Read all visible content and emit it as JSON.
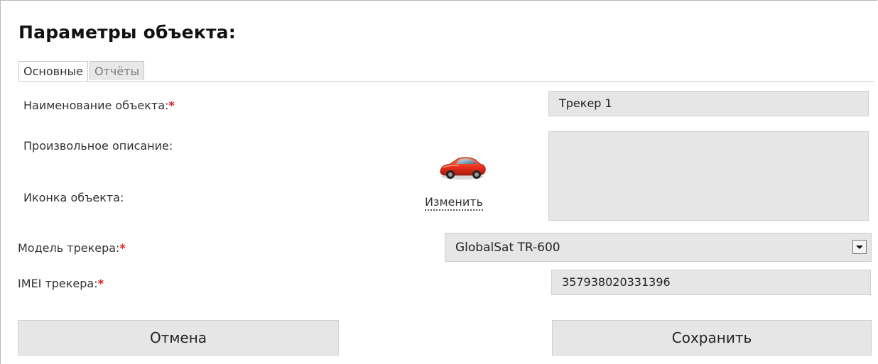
{
  "page": {
    "title": "Параметры объекта:"
  },
  "tabs": [
    {
      "label": "Основные",
      "active": true
    },
    {
      "label": "Отчёты",
      "active": false
    }
  ],
  "form": {
    "name_label": "Наименование объекта:",
    "name_value": "Трекер 1",
    "description_label": "Произвольное описание:",
    "description_value": "",
    "icon_label": "Иконка объекта:",
    "icon_semantic": "red-sports-car-icon",
    "change_icon_label": "Изменить",
    "model_label": "Модель трекера:",
    "model_value": "GlobalSat TR-600",
    "imei_label": "IMEI трекера:",
    "imei_value": "357938020331396",
    "required_mark": "*"
  },
  "buttons": {
    "cancel_label": "Отмена",
    "save_label": "Сохранить"
  },
  "colors": {
    "required": "#e02020",
    "field_bg": "#e6e6e6",
    "car_body": "#e8301c"
  }
}
